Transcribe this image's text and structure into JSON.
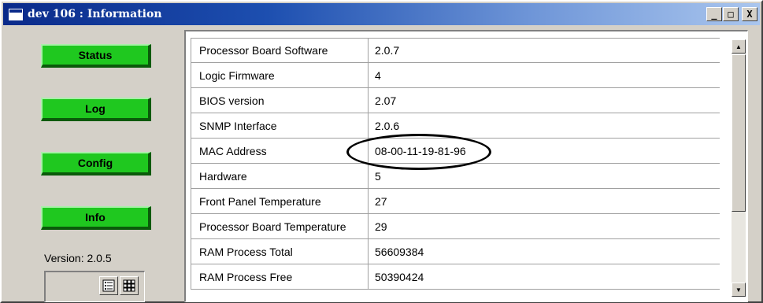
{
  "window": {
    "title": "dev 106 : Information",
    "minimize": "_",
    "maximize": "□",
    "close": "X"
  },
  "sidebar": {
    "buttons": [
      {
        "label": "Status"
      },
      {
        "label": "Log"
      },
      {
        "label": "Config"
      },
      {
        "label": "Info"
      }
    ],
    "version": "Version: 2.0.5"
  },
  "info": {
    "rows": [
      {
        "label": "Processor Board Software",
        "value": "2.0.7"
      },
      {
        "label": "Logic Firmware",
        "value": "4"
      },
      {
        "label": "BIOS version",
        "value": "2.07"
      },
      {
        "label": "SNMP Interface",
        "value": "2.0.6"
      },
      {
        "label": "MAC Address",
        "value": "08-00-11-19-81-96"
      },
      {
        "label": "Hardware",
        "value": "5"
      },
      {
        "label": "Front Panel Temperature",
        "value": "27"
      },
      {
        "label": "Processor Board Temperature",
        "value": "29"
      },
      {
        "label": "RAM Process Total",
        "value": "56609384"
      },
      {
        "label": "RAM Process Free",
        "value": "50390424"
      }
    ]
  },
  "icons": {
    "list_view": "list-view-icon",
    "grid_view": "grid-view-icon"
  },
  "colors": {
    "button_green": "#1fc81f",
    "title_blue": "#0a2a8a"
  }
}
